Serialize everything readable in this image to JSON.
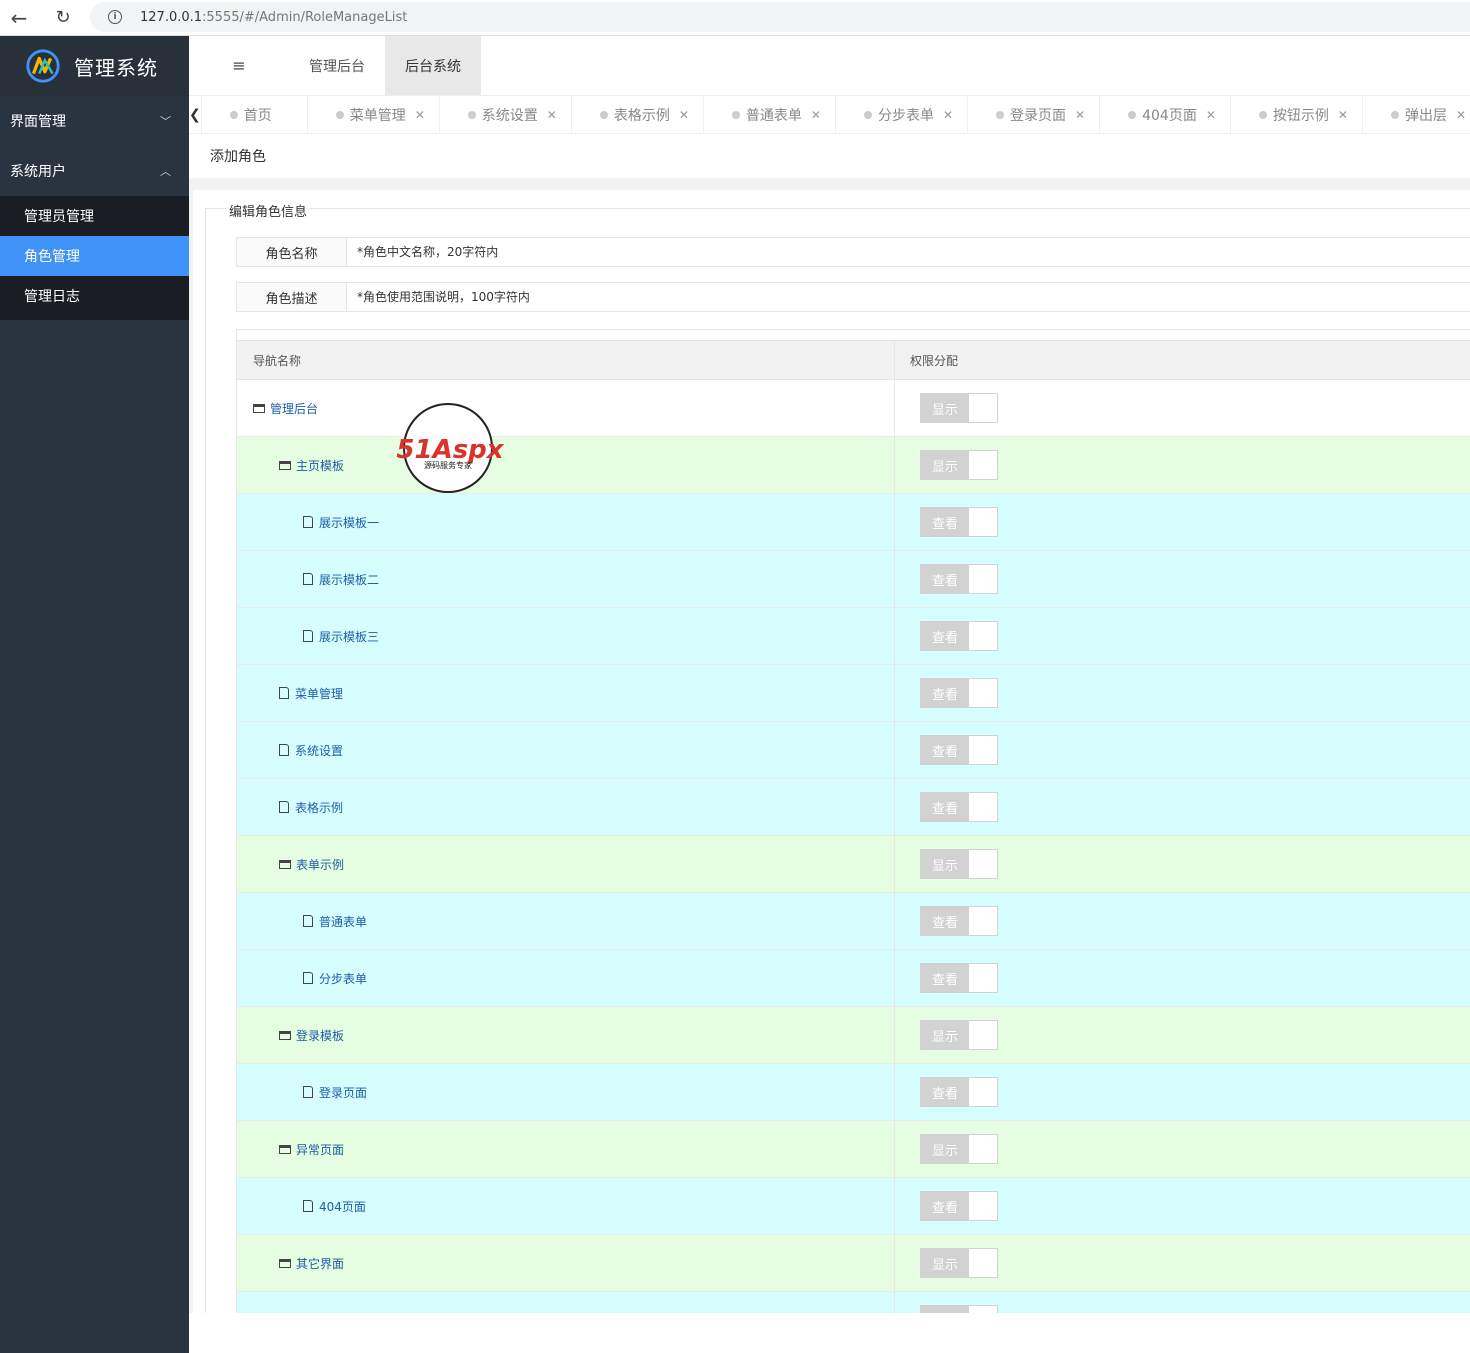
{
  "browser": {
    "url_host": "127.0.0.1",
    "url_rest": ":5555/#/Admin/RoleManageList"
  },
  "sidebar": {
    "logo_text": "管理系统",
    "groups": [
      {
        "label": "界面管理",
        "expanded": false
      },
      {
        "label": "系统用户",
        "expanded": true
      }
    ],
    "items": [
      {
        "label": "管理员管理",
        "active": false
      },
      {
        "label": "角色管理",
        "active": true
      },
      {
        "label": "管理日志",
        "active": false
      }
    ]
  },
  "header": {
    "tabs": [
      {
        "label": "管理后台",
        "active": false
      },
      {
        "label": "后台系统",
        "active": true
      }
    ]
  },
  "tabs": [
    {
      "label": "首页",
      "closable": false
    },
    {
      "label": "菜单管理",
      "closable": true
    },
    {
      "label": "系统设置",
      "closable": true
    },
    {
      "label": "表格示例",
      "closable": true
    },
    {
      "label": "普通表单",
      "closable": true
    },
    {
      "label": "分步表单",
      "closable": true
    },
    {
      "label": "登录页面",
      "closable": true
    },
    {
      "label": "404页面",
      "closable": true
    },
    {
      "label": "按钮示例",
      "closable": true
    },
    {
      "label": "弹出层",
      "closable": true
    }
  ],
  "page": {
    "title": "添加角色",
    "legend": "编辑角色信息",
    "fields": [
      {
        "label": "角色名称",
        "placeholder": "*角色中文名称，20字符内"
      },
      {
        "label": "角色描述",
        "placeholder": "*角色使用范围说明，100字符内"
      }
    ],
    "table": {
      "col_nav": "导航名称",
      "col_perm": "权限分配",
      "rows": [
        {
          "label": "管理后台",
          "level": 0,
          "type": "folder",
          "switch": "显示"
        },
        {
          "label": "主页模板",
          "level": 1,
          "type": "folder",
          "switch": "显示"
        },
        {
          "label": "展示模板一",
          "level": 2,
          "type": "file",
          "switch": "查看"
        },
        {
          "label": "展示模板二",
          "level": 2,
          "type": "file",
          "switch": "查看"
        },
        {
          "label": "展示模板三",
          "level": 2,
          "type": "file",
          "switch": "查看"
        },
        {
          "label": "菜单管理",
          "level": 1,
          "type": "file",
          "switch": "查看"
        },
        {
          "label": "系统设置",
          "level": 1,
          "type": "file",
          "switch": "查看"
        },
        {
          "label": "表格示例",
          "level": 1,
          "type": "file",
          "switch": "查看"
        },
        {
          "label": "表单示例",
          "level": 1,
          "type": "folder",
          "switch": "显示"
        },
        {
          "label": "普通表单",
          "level": 2,
          "type": "file",
          "switch": "查看"
        },
        {
          "label": "分步表单",
          "level": 2,
          "type": "file",
          "switch": "查看"
        },
        {
          "label": "登录模板",
          "level": 1,
          "type": "folder",
          "switch": "显示"
        },
        {
          "label": "登录页面",
          "level": 2,
          "type": "file",
          "switch": "查看"
        },
        {
          "label": "异常页面",
          "level": 1,
          "type": "folder",
          "switch": "显示"
        },
        {
          "label": "404页面",
          "level": 2,
          "type": "file",
          "switch": "查看"
        },
        {
          "label": "其它界面",
          "level": 1,
          "type": "folder",
          "switch": "显示"
        },
        {
          "label": "",
          "level": 2,
          "type": "file",
          "switch": ""
        }
      ]
    }
  },
  "watermark": {
    "brand": "51Aspx",
    "tagline": "源码服务专家"
  },
  "colors": {
    "sidebar_bg": "#2a3440",
    "active_blue": "#3f93f7",
    "folder_row": "#e5fde0",
    "leaf_row": "#d7fefe",
    "link_blue": "#1e5da8"
  }
}
